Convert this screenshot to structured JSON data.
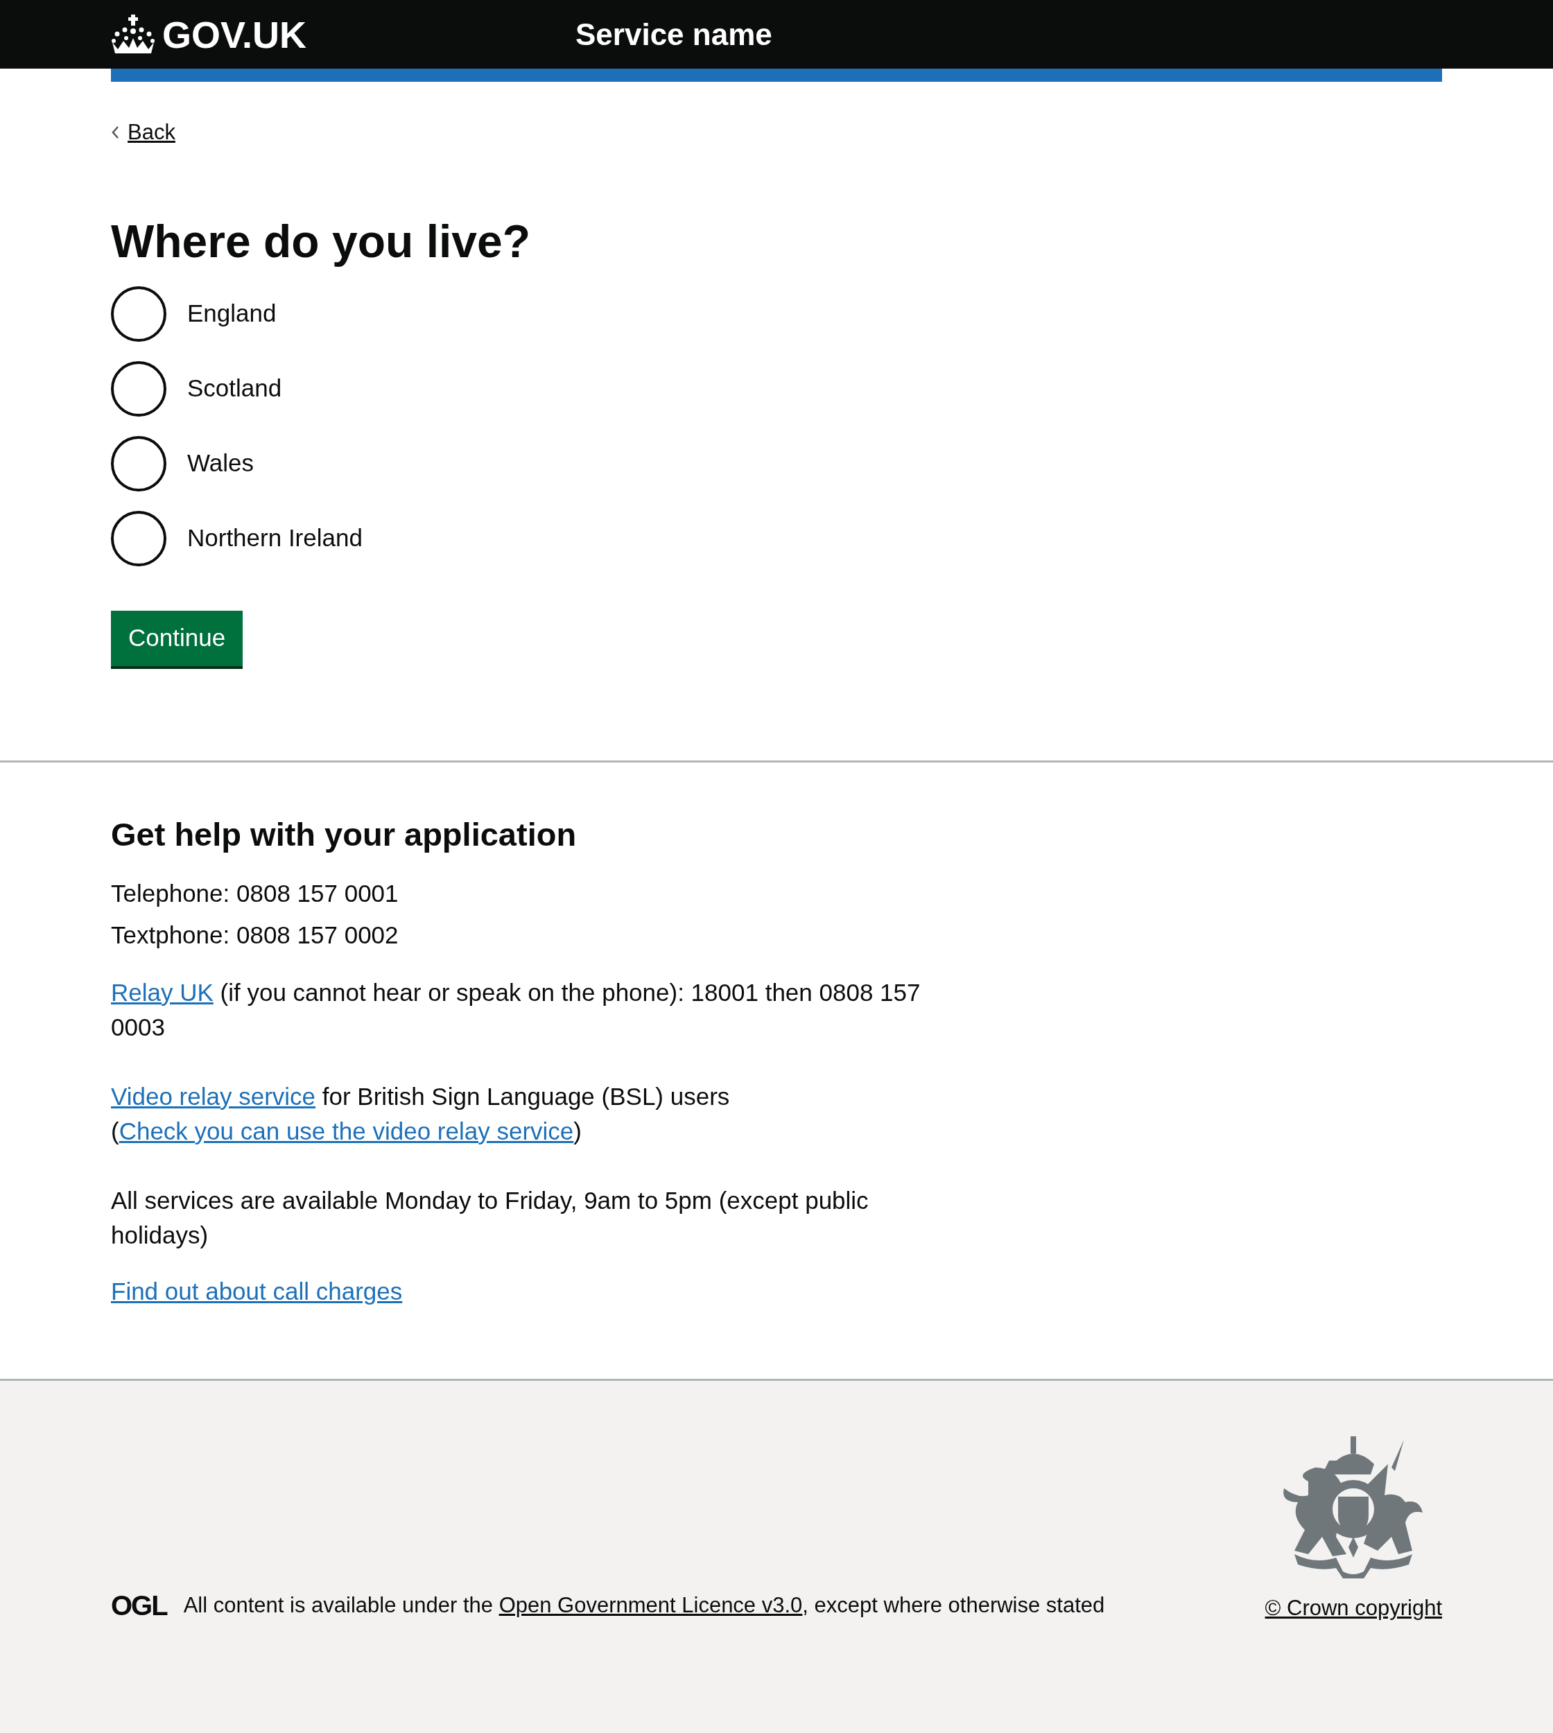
{
  "header": {
    "logo_text": "GOV.UK",
    "service_name": "Service name"
  },
  "back_link": "Back",
  "question": {
    "title": "Where do you live?",
    "options": [
      {
        "label": "England",
        "selected": false
      },
      {
        "label": "Scotland",
        "selected": false
      },
      {
        "label": "Wales",
        "selected": false
      },
      {
        "label": "Northern Ireland",
        "selected": false
      }
    ]
  },
  "continue_button": "Continue",
  "help": {
    "title": "Get help with your application",
    "contact_lines": [
      "Telephone: 0808 157 0001",
      "Textphone: 0808 157 0002"
    ],
    "paragraphs": [
      [
        {
          "kind": "link",
          "text": "Relay UK"
        },
        {
          "kind": "text",
          "text": " (if you cannot hear or speak on the phone): 18001 then 0808 157 0003"
        }
      ],
      [
        {
          "kind": "link",
          "text": "Video relay service"
        },
        {
          "kind": "text",
          "text": " for British Sign Language (BSL) users ("
        },
        {
          "kind": "link",
          "text": "Check you can use the video relay service"
        },
        {
          "kind": "text",
          "text": ")"
        }
      ],
      [
        {
          "kind": "text",
          "text": "All services are available Monday to Friday, 9am to 5pm (except public holidays)"
        }
      ]
    ],
    "charges_link": "Find out about call charges"
  },
  "footer": {
    "licence": [
      {
        "kind": "text",
        "text": "All content is available under the "
      },
      {
        "kind": "link",
        "text": "Open Government Licence v3.0"
      },
      {
        "kind": "text",
        "text": ", except where otherwise stated"
      }
    ],
    "ogl_logo": "OGL",
    "copyright": "© Crown copyright"
  }
}
